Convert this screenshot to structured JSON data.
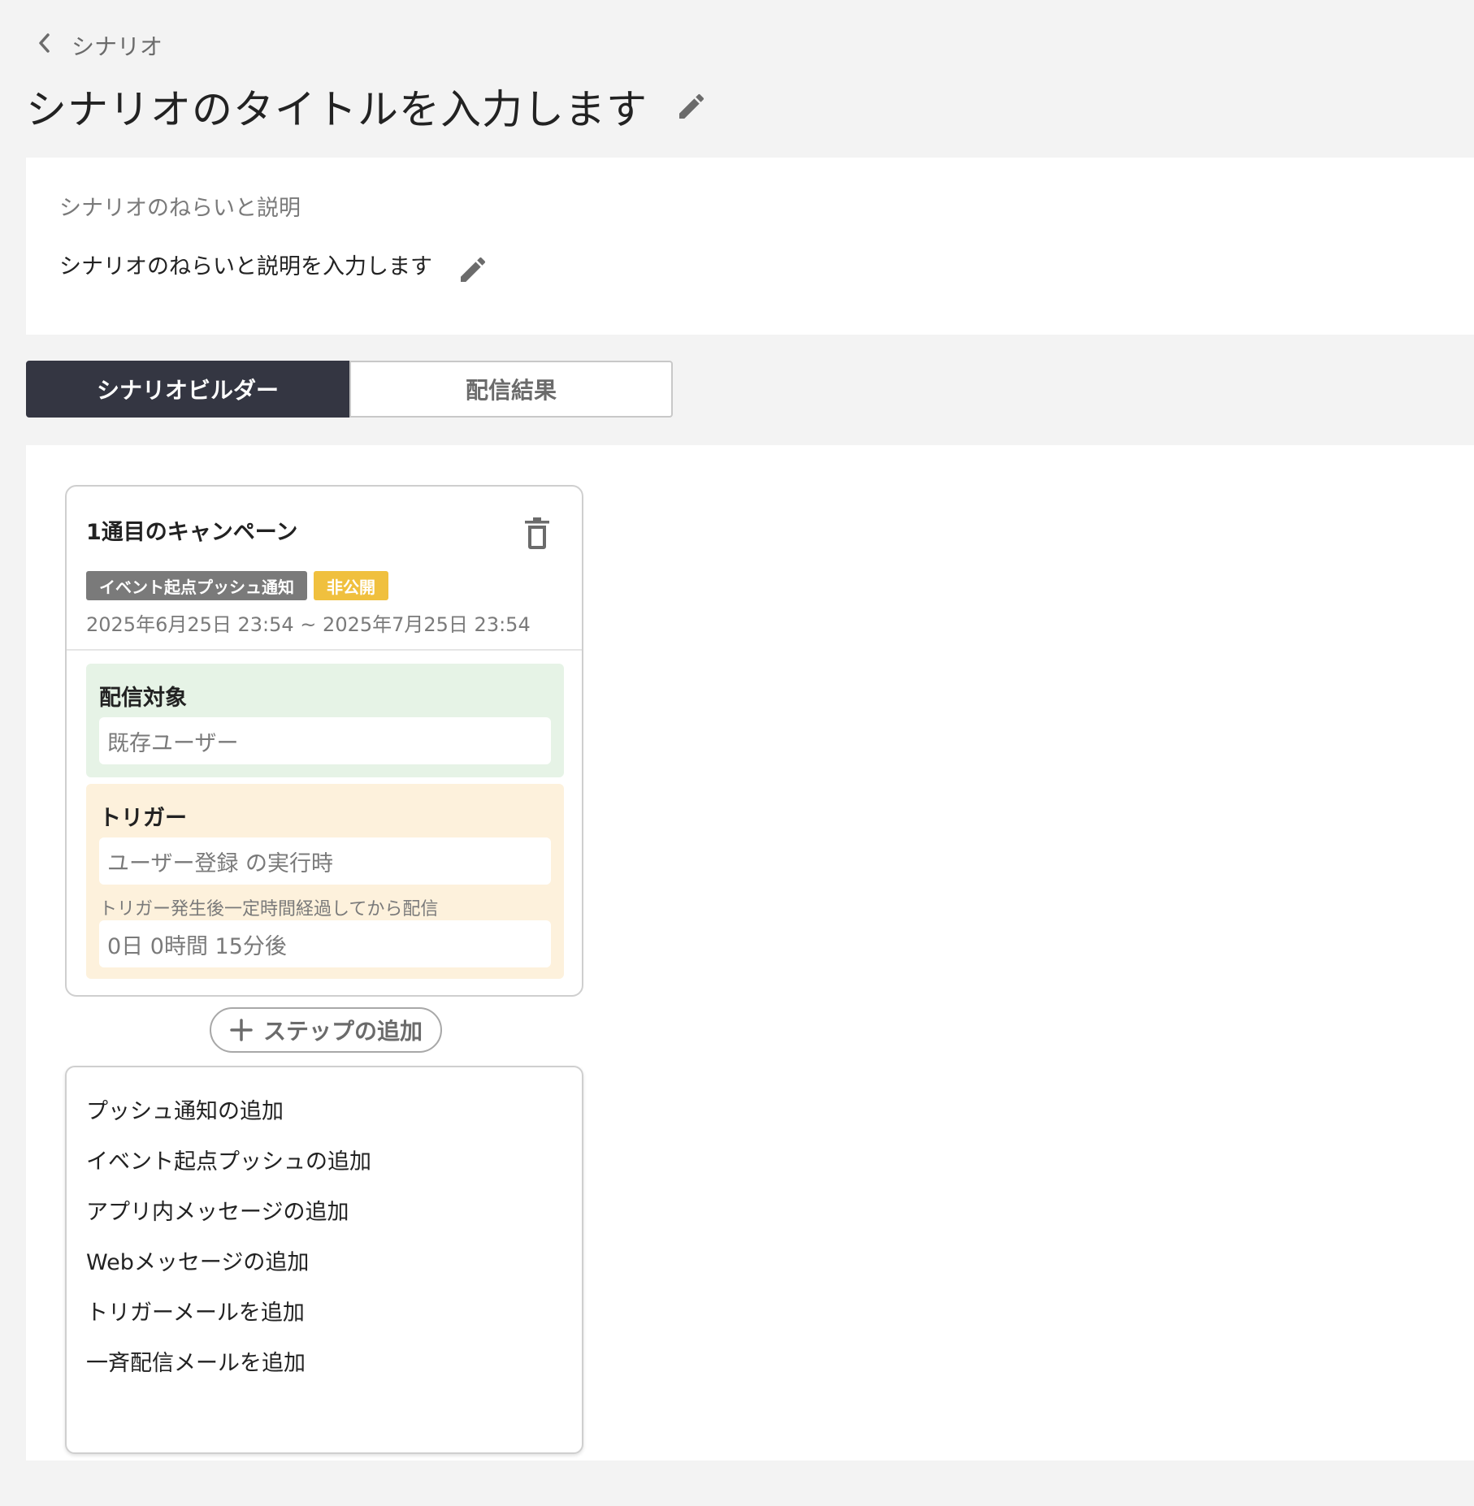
{
  "breadcrumb": {
    "label": "シナリオ"
  },
  "header": {
    "title": "シナリオのタイトルを入力します"
  },
  "description": {
    "label": "シナリオのねらいと説明",
    "text": "シナリオのねらいと説明を入力します"
  },
  "tabs": [
    {
      "label": "シナリオビルダー",
      "active": true
    },
    {
      "label": "配信結果",
      "active": false
    }
  ],
  "step": {
    "title": "1通目のキャンペーン",
    "badges": [
      {
        "label": "イベント起点プッシュ通知",
        "color": "#7a7a7a"
      },
      {
        "label": "非公開",
        "color": "#f0c03e"
      }
    ],
    "period": "2025年6月25日 23:54 ~ 2025年7月25日 23:54",
    "target": {
      "title": "配信対象",
      "value": "既存ユーザー"
    },
    "trigger": {
      "title": "トリガー",
      "value": "ユーザー登録 の実行時",
      "note": "トリガー発生後一定時間経過してから配信",
      "delay": "0日 0時間 15分後"
    }
  },
  "add_step": {
    "label": "ステップの追加"
  },
  "menu": {
    "items": [
      "プッシュ通知の追加",
      "イベント起点プッシュの追加",
      "アプリ内メッセージの追加",
      "Webメッセージの追加",
      "トリガーメールを追加",
      "一斉配信メールを追加"
    ]
  },
  "colors": {
    "tab_active": "#343642",
    "target_bg": "#e6f3e6",
    "trigger_bg": "#fdf1dc",
    "page_bg": "#f3f3f3"
  }
}
